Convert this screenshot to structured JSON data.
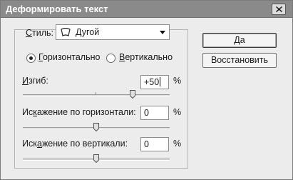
{
  "window": {
    "title": "Деформировать текст"
  },
  "style": {
    "label": "Стиль:",
    "value": "Дугой"
  },
  "orientation": {
    "horizontal_label": "Горизонтально",
    "vertical_label": "Вертикально",
    "selected": "horizontal"
  },
  "bend": {
    "label": "Изгиб:",
    "value": "+50",
    "unit": "%",
    "slider_percent": 50
  },
  "h_distortion": {
    "label": "Искажение по горизонтали:",
    "value": "0",
    "unit": "%",
    "slider_percent": 0
  },
  "v_distortion": {
    "label": "Искажение по вертикали:",
    "value": "0",
    "unit": "%",
    "slider_percent": 0
  },
  "buttons": {
    "ok": "Да",
    "reset": "Восстановить"
  }
}
